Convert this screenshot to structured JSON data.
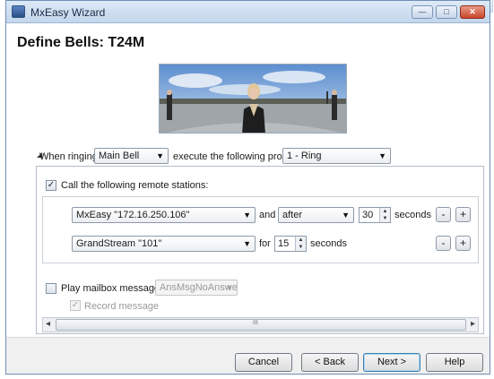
{
  "window": {
    "title": "MxEasy Wizard",
    "minimize_label": "—",
    "maximize_label": "□",
    "close_label": "✕"
  },
  "page": {
    "heading": "Define Bells: T24M"
  },
  "ringing": {
    "when_label": "When ringing:",
    "bell_value": "Main Bell",
    "execute_label": "execute the following profile:",
    "profile_value": "1 - Ring"
  },
  "remote": {
    "checked": true,
    "check_mark": "✓",
    "label": "Call the following remote stations:",
    "rows": [
      {
        "station": "MxEasy \"172.16.250.106\"",
        "conj": "and",
        "timing": "after",
        "seconds": "30",
        "unit": "seconds",
        "minus": "-",
        "plus": "+"
      },
      {
        "station": "GrandStream \"101\"",
        "conj": "for",
        "seconds": "15",
        "unit": "seconds",
        "minus": "-",
        "plus": "+"
      }
    ]
  },
  "mailbox": {
    "checked": false,
    "label": "Play mailbox message:",
    "message_value": "AnsMsgNoAnswer",
    "record_checked": true,
    "record_mark": "✓",
    "record_label": "Record message"
  },
  "scrollbar": {
    "left_arrow": "◂",
    "right_arrow": "▸",
    "grip": "III"
  },
  "buttons": {
    "cancel": "Cancel",
    "back": "< Back",
    "next": "Next >",
    "help": "Help"
  },
  "icons": {
    "dropdown": "▼",
    "spin_up": "▲",
    "spin_down": "▼",
    "collapse": "◢"
  },
  "colors": {
    "title_bar": "#c3d6ec",
    "close_button": "#c8452a",
    "border": "#6e8db4"
  }
}
